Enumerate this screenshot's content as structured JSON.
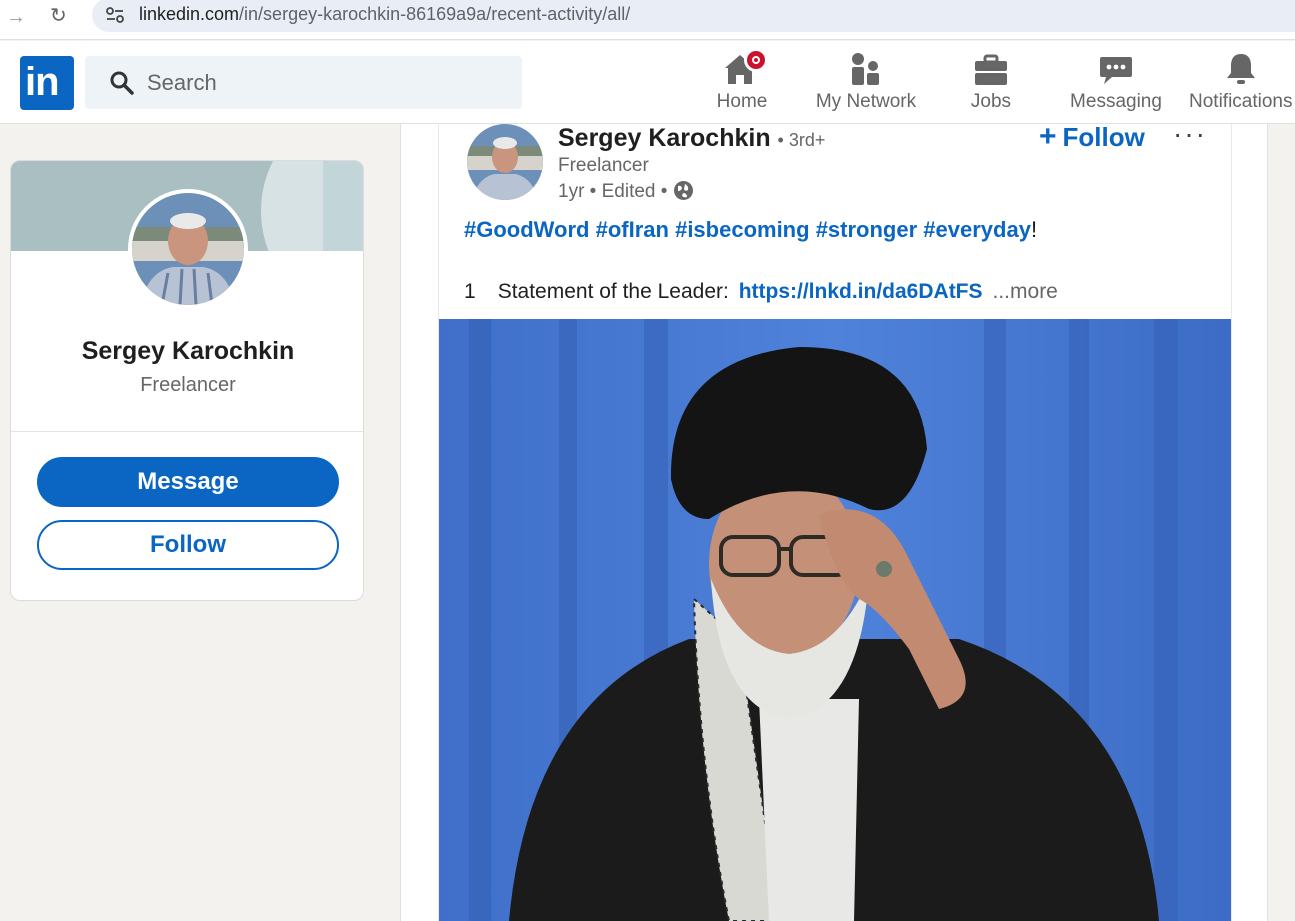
{
  "browser": {
    "url_host": "linkedin.com",
    "url_path": "/in/sergey-karochkin-86169a9a/recent-activity/all/"
  },
  "header": {
    "logo_text": "in",
    "search_placeholder": "Search",
    "nav": [
      {
        "label": "Home",
        "icon": "home-icon",
        "has_badge": true
      },
      {
        "label": "My Network",
        "icon": "people-icon"
      },
      {
        "label": "Jobs",
        "icon": "briefcase-icon"
      },
      {
        "label": "Messaging",
        "icon": "chat-bubble-icon"
      },
      {
        "label": "Notifications",
        "icon": "bell-icon"
      }
    ]
  },
  "profile_card": {
    "name": "Sergey Karochkin",
    "headline": "Freelancer",
    "message_label": "Message",
    "follow_label": "Follow"
  },
  "post": {
    "author": "Sergey Karochkin",
    "degree": "• 3rd+",
    "headline": "Freelancer",
    "meta": "1yr • Edited •",
    "follow_label": "Follow",
    "more_label": "···",
    "hashtags": [
      "#GoodWord",
      "#ofIran",
      "#isbecoming",
      "#stronger",
      "#everyday"
    ],
    "hashtag_suffix": "!",
    "line_number": "1",
    "line_text": "Statement of the Leader:",
    "link_text": "https://lnkd.in/da6DAtFS",
    "see_more": "...more"
  },
  "colors": {
    "brand": "#0a66c2",
    "badge": "#cb112d",
    "page_bg": "#f4f2ee"
  }
}
